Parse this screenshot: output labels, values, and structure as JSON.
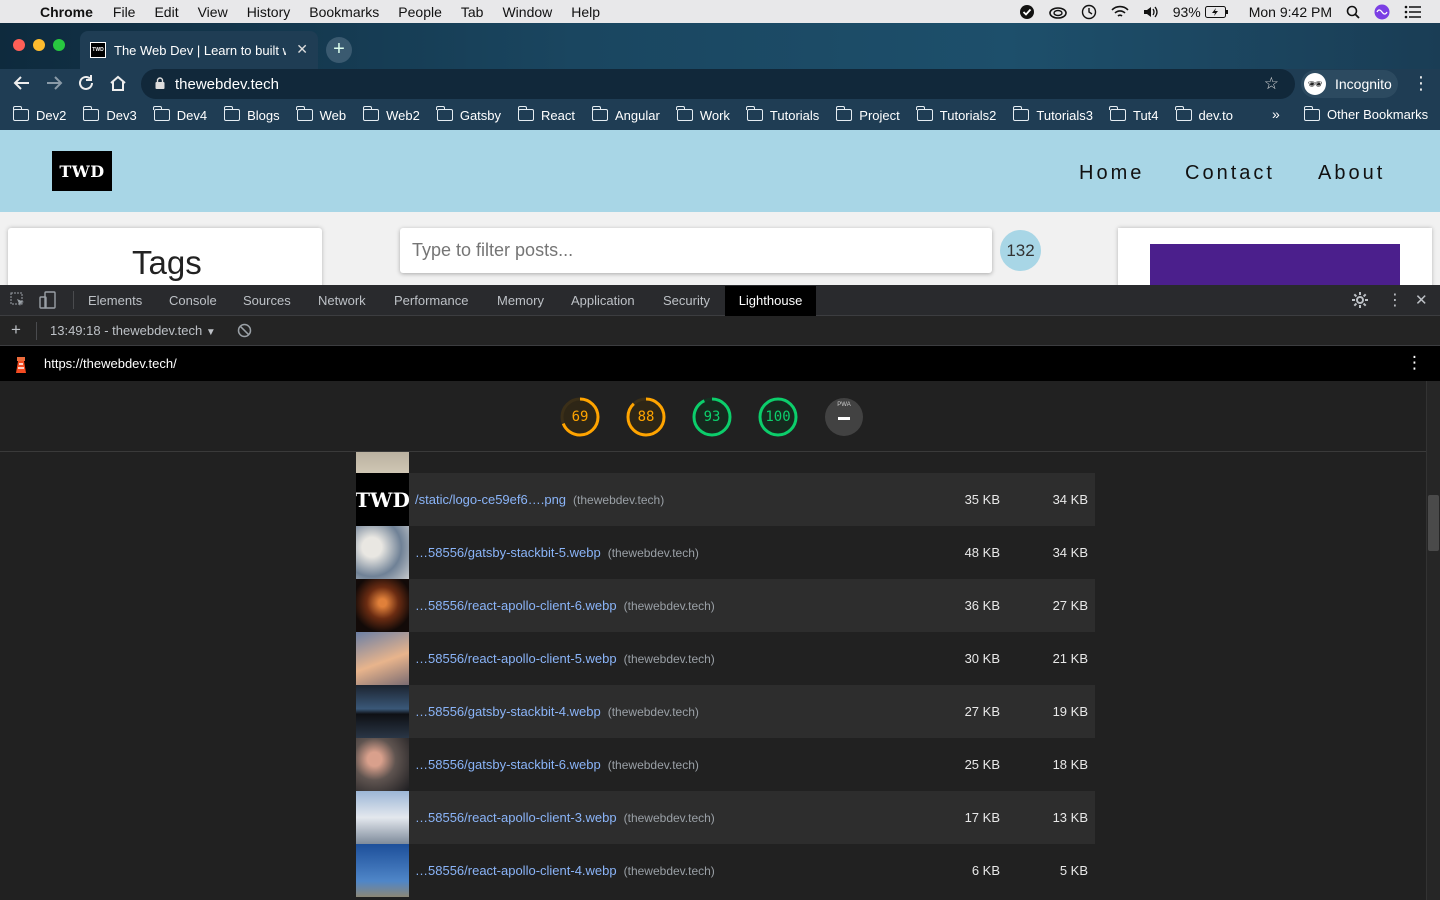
{
  "menubar": {
    "apple": "",
    "app": "Chrome",
    "items": [
      "File",
      "Edit",
      "View",
      "History",
      "Bookmarks",
      "People",
      "Tab",
      "Window",
      "Help"
    ],
    "battery": "93%",
    "clock": "Mon 9:42 PM"
  },
  "browser": {
    "tab_title": "The Web Dev | Learn to built web",
    "tab_favicon": "TWD",
    "url": "thewebdev.tech",
    "profile": "Incognito",
    "bookmarks": [
      "Dev2",
      "Dev3",
      "Dev4",
      "Blogs",
      "Web",
      "Web2",
      "Gatsby",
      "React",
      "Angular",
      "Work",
      "Tutorials",
      "Project",
      "Tutorials2",
      "Tutorials3",
      "Tut4",
      "dev.to"
    ],
    "bookmarks_more": "»",
    "other_bookmarks": "Other Bookmarks"
  },
  "site": {
    "logo": "TWD",
    "nav": [
      "Home",
      "Contact",
      "About"
    ],
    "tags_heading": "Tags",
    "filter_placeholder": "Type to filter posts...",
    "post_count": "132"
  },
  "devtools": {
    "tabs": [
      "Elements",
      "Console",
      "Sources",
      "Network",
      "Performance",
      "Memory",
      "Application",
      "Security",
      "Lighthouse"
    ],
    "active_tab": "Lighthouse",
    "report_selector": "13:49:18 - thewebdev.tech",
    "report_url": "https://thewebdev.tech/",
    "scores": [
      {
        "value": "69",
        "color": "#ffa400"
      },
      {
        "value": "88",
        "color": "#ffa400"
      },
      {
        "value": "93",
        "color": "#0cce6b"
      },
      {
        "value": "100",
        "color": "#0cce6b"
      }
    ],
    "pwa_label": "PWA",
    "rows": [
      {
        "url": "/static/logo-ce59ef6….png",
        "host": "(thewebdev.tech)",
        "size": "35 KB",
        "savings": "34 KB",
        "thumb": "twd-logo"
      },
      {
        "url": "…58556/gatsby-stackbit-5.webp",
        "host": "(thewebdev.tech)",
        "size": "48 KB",
        "savings": "34 KB",
        "thumb": "desk"
      },
      {
        "url": "…58556/react-apollo-client-6.webp",
        "host": "(thewebdev.tech)",
        "size": "36 KB",
        "savings": "27 KB",
        "thumb": "night-arch"
      },
      {
        "url": "…58556/react-apollo-client-5.webp",
        "host": "(thewebdev.tech)",
        "size": "30 KB",
        "savings": "21 KB",
        "thumb": "rocket-sunset"
      },
      {
        "url": "…58556/gatsby-stackbit-4.webp",
        "host": "(thewebdev.tech)",
        "size": "27 KB",
        "savings": "19 KB",
        "thumb": "monitors"
      },
      {
        "url": "…58556/gatsby-stackbit-6.webp",
        "host": "(thewebdev.tech)",
        "size": "25 KB",
        "savings": "18 KB",
        "thumb": "typing-hands"
      },
      {
        "url": "…58556/react-apollo-client-3.webp",
        "host": "(thewebdev.tech)",
        "size": "17 KB",
        "savings": "13 KB",
        "thumb": "rocket-launch"
      },
      {
        "url": "…58556/react-apollo-client-4.webp",
        "host": "(thewebdev.tech)",
        "size": "6 KB",
        "savings": "5 KB",
        "thumb": "blue-sky"
      }
    ]
  }
}
